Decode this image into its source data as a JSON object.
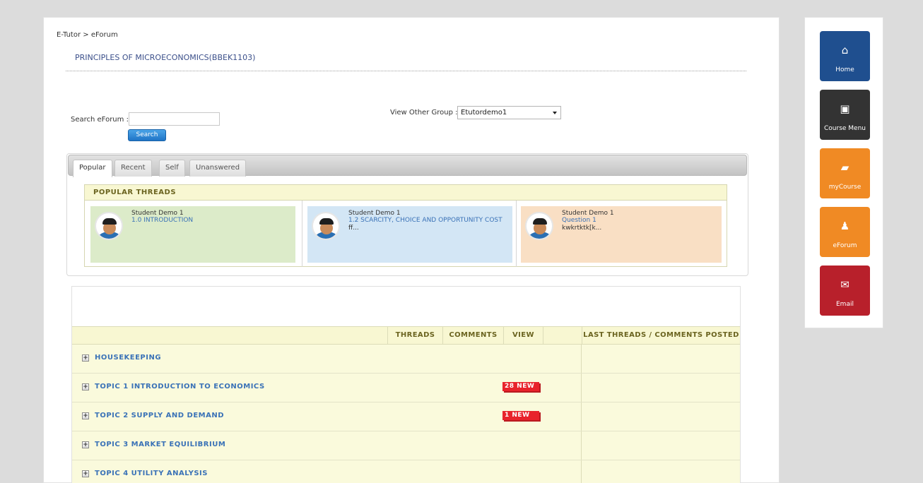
{
  "breadcrumb": "E-Tutor > eForum",
  "course_title": "PRINCIPLES OF MICROECONOMICS(BBEK1103)",
  "search": {
    "label": "Search eForum :",
    "value": "",
    "button_label": "Search"
  },
  "group": {
    "label": "View Other Group :",
    "selected": "Etutordemo1"
  },
  "tabs": [
    {
      "label": "Popular",
      "active": true
    },
    {
      "label": "Recent",
      "active": false
    },
    {
      "label": "Self",
      "active": false
    },
    {
      "label": "Unanswered",
      "active": false
    }
  ],
  "popular": {
    "header": "POPULAR THREADS",
    "threads": [
      {
        "author": "Student Demo 1",
        "title": "1.0 INTRODUCTION",
        "extra": "",
        "extra2": "",
        "bg": "#dcebc9"
      },
      {
        "author": "Student Demo 1",
        "title": "1.2 SCARCITY, CHOICE AND OPPORTUNITY COST",
        "extra": "ff...",
        "extra2": "",
        "bg": "#d3e6f5"
      },
      {
        "author": "Student Demo 1",
        "title": "Question 1",
        "extra": "kwkrtktk[k...",
        "extra2": "",
        "bg": "#f9dfc4"
      }
    ]
  },
  "forum_table": {
    "headers": {
      "threads": "THREADS",
      "comments": "COMMENTS",
      "view": "VIEW",
      "last_posted": "LAST THREADS / COMMENTS POSTED"
    },
    "topics": [
      {
        "label": "HOUSEKEEPING",
        "new": ""
      },
      {
        "label": "TOPIC 1 INTRODUCTION TO ECONOMICS",
        "new": "28 NEW"
      },
      {
        "label": "TOPIC 2 SUPPLY AND DEMAND",
        "new": "1 NEW"
      },
      {
        "label": "TOPIC 3 MARKET EQUILIBRIUM",
        "new": ""
      },
      {
        "label": "TOPIC 4 UTILITY ANALYSIS",
        "new": ""
      }
    ]
  },
  "side_nav": [
    {
      "label": "Home",
      "icon": "home-icon",
      "glyph": "⌂",
      "color": "#1f4f8f"
    },
    {
      "label": "Course Menu",
      "icon": "course-menu-icon",
      "glyph": "▣",
      "color": "#333333"
    },
    {
      "label": "myCourse",
      "icon": "notebook-icon",
      "glyph": "▰",
      "color": "#f08a24"
    },
    {
      "label": "eForum",
      "icon": "people-icon",
      "glyph": "♟",
      "color": "#f08a24"
    },
    {
      "label": "Email",
      "icon": "envelope-icon",
      "glyph": "✉",
      "color": "#b8202b"
    }
  ]
}
